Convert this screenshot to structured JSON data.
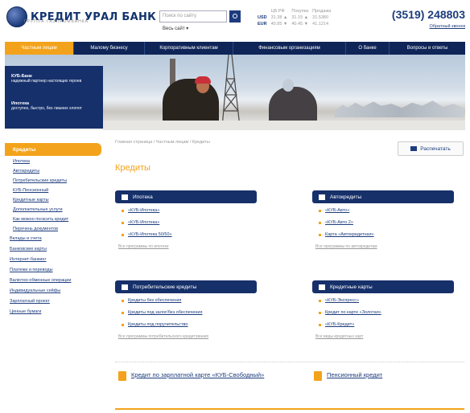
{
  "header": {
    "logo_text": "КРЕДИТ УРАЛ БАНК",
    "logo_sub": "ГРУППА ГАЗПРОМБАНКА",
    "search_placeholder": "Поиск по сайту",
    "search_sub": "Весь сайт ▾",
    "phone": "(3519) 248803",
    "phone_link": "Обратный звонок"
  },
  "rates": {
    "headers": [
      "",
      "ЦБ РФ",
      "Покупка",
      "Продажа"
    ],
    "rows": [
      {
        "cur": "USD",
        "cbr": "31.38 ▲",
        "buy": "31.15 ▲",
        "sell": "31.5380"
      },
      {
        "cur": "EUR",
        "cbr": "40.85 ▼",
        "buy": "40.45 ▼",
        "sell": "41.1214"
      }
    ]
  },
  "nav": {
    "items": [
      {
        "label": "Частным лицам",
        "active": true
      },
      {
        "label": "Малому бизнесу",
        "active": false
      },
      {
        "label": "Корпоративным клиентам",
        "active": false
      },
      {
        "label": "Финансовым организациям",
        "active": false
      },
      {
        "label": "О банке",
        "active": false
      },
      {
        "label": "Вопросы и ответы",
        "active": false
      }
    ]
  },
  "banner": {
    "items": [
      {
        "title": "КУБ-Банк",
        "text": "надежный партнер настоящих героев"
      },
      {
        "title": "Ипотека",
        "text": "доступно, быстро, без лишних хлопот"
      }
    ]
  },
  "sidebar": {
    "header": "Кредиты",
    "sub_items": [
      "Ипотека",
      "Автокредиты",
      "Потребительские кредиты",
      "КУБ-Пенсионный",
      "Кредитные карты",
      "Дополнительные услуги",
      "Как можно погасить кредит",
      "Перечень документов"
    ],
    "main_items": [
      "Вклады и счета",
      "Банковские карты",
      "Интернет-банкинг",
      "Платежи и переводы",
      "Валютно-обменные операции",
      "Индивидуальные сейфы",
      "Зарплатный проект",
      "Ценные бумаги"
    ]
  },
  "main": {
    "breadcrumb": "Главная страница / Частным лицам / Кредиты",
    "print_label": "Распечатать",
    "title": "Кредиты",
    "sections": [
      {
        "title": "Ипотека",
        "links": [
          "«КУБ-Ипотека»",
          "«КУБ-Ипотека»",
          "«КУБ-Ипотека 50/50»"
        ],
        "all": "Все программы по ипотеке"
      },
      {
        "title": "Автокредиты",
        "links": [
          "«КУБ-Авто»",
          "«КУБ-Авто 2»",
          "Карта «Автокредитная»"
        ],
        "all": "Все программы по автокредитам"
      },
      {
        "title": "Потребительские кредиты",
        "links": [
          "Кредиты без обеспечения",
          "Кредиты под залог/без обеспечения",
          "Кредиты под поручительство"
        ],
        "all": "Все программы потребительского кредитования"
      },
      {
        "title": "Кредитные карты",
        "links": [
          "«КУБ-Экспресс»",
          "Кредит по карте «Золотая»",
          "«КУБ-Кредит»"
        ],
        "all": "Все виды кредитных карт"
      }
    ],
    "promos": [
      {
        "text": "Кредит по зарплатной карте «КУБ-Свободный»"
      },
      {
        "text": "Пенсионный кредит"
      }
    ]
  }
}
